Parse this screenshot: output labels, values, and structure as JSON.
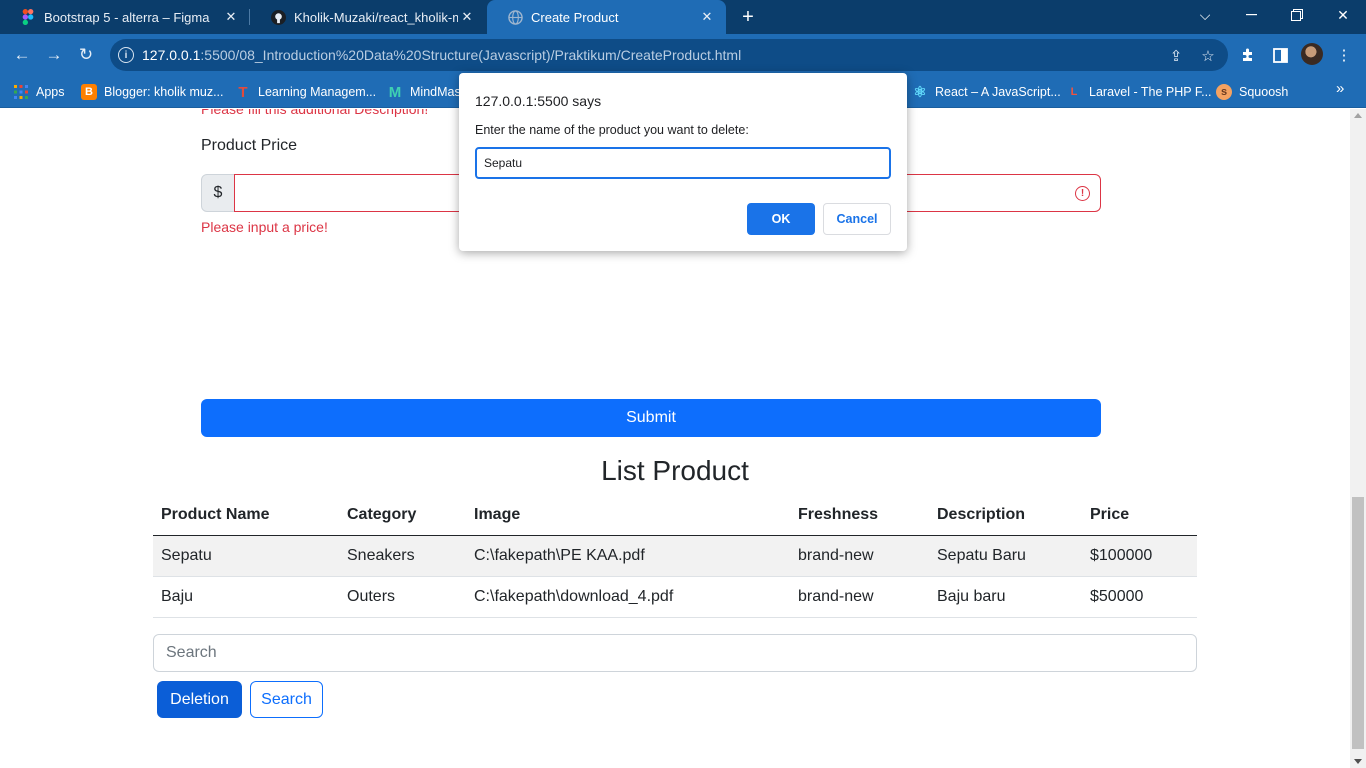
{
  "browser": {
    "tabs": [
      {
        "label": "Bootstrap 5 - alterra – Figma",
        "favicon": "figma-icon"
      },
      {
        "label": "Kholik-Muzaki/react_kholik-muzaki",
        "favicon": "github-icon"
      },
      {
        "label": "Create Product",
        "favicon": "globe-icon",
        "active": true
      }
    ],
    "url_host": "127.0.0.1",
    "url_rest": ":5500/08_Introduction%20Data%20Structure(Javascript)/Praktikum/CreateProduct.html",
    "bookmarks": [
      {
        "label": "Apps",
        "icon": "apps-grid-icon"
      },
      {
        "label": "Blogger: kholik muz...",
        "icon": "blogger-icon"
      },
      {
        "label": "Learning Managem...",
        "icon": "lms-icon"
      },
      {
        "label": "MindMas",
        "icon": "mindmaster-icon"
      },
      {
        "label": "React – A JavaScript...",
        "icon": "react-icon"
      },
      {
        "label": "Laravel - The PHP F...",
        "icon": "laravel-icon"
      },
      {
        "label": "Squoosh",
        "icon": "squoosh-icon"
      }
    ],
    "colors": {
      "tabstrip": "#0b3d6b",
      "toolbar": "#1f6cb5"
    }
  },
  "form": {
    "description_error": "Please fill this additional Description!",
    "price_label": "Product Price",
    "currency_symbol": "$",
    "price_value": "",
    "price_error": "Please input a price!",
    "submit_label": "Submit"
  },
  "list": {
    "title": "List Product",
    "columns": [
      "Product Name",
      "Category",
      "Image",
      "Freshness",
      "Description",
      "Price"
    ],
    "rows": [
      [
        "Sepatu",
        "Sneakers",
        "C:\\fakepath\\PE KAA.pdf",
        "brand-new",
        "Sepatu Baru",
        "$100000"
      ],
      [
        "Baju",
        "Outers",
        "C:\\fakepath\\download_4.pdf",
        "brand-new",
        "Baju baru",
        "$50000"
      ]
    ],
    "search_placeholder": "Search",
    "deletion_label": "Deletion",
    "search_label": "Search"
  },
  "dialog": {
    "title": "127.0.0.1:5500 says",
    "message": "Enter the name of the product you want to delete:",
    "input_value": "Sepatu",
    "ok_label": "OK",
    "cancel_label": "Cancel"
  },
  "colors": {
    "primary": "#0d6efd",
    "danger": "#dc3545",
    "dialog_accent": "#1a73e8"
  }
}
